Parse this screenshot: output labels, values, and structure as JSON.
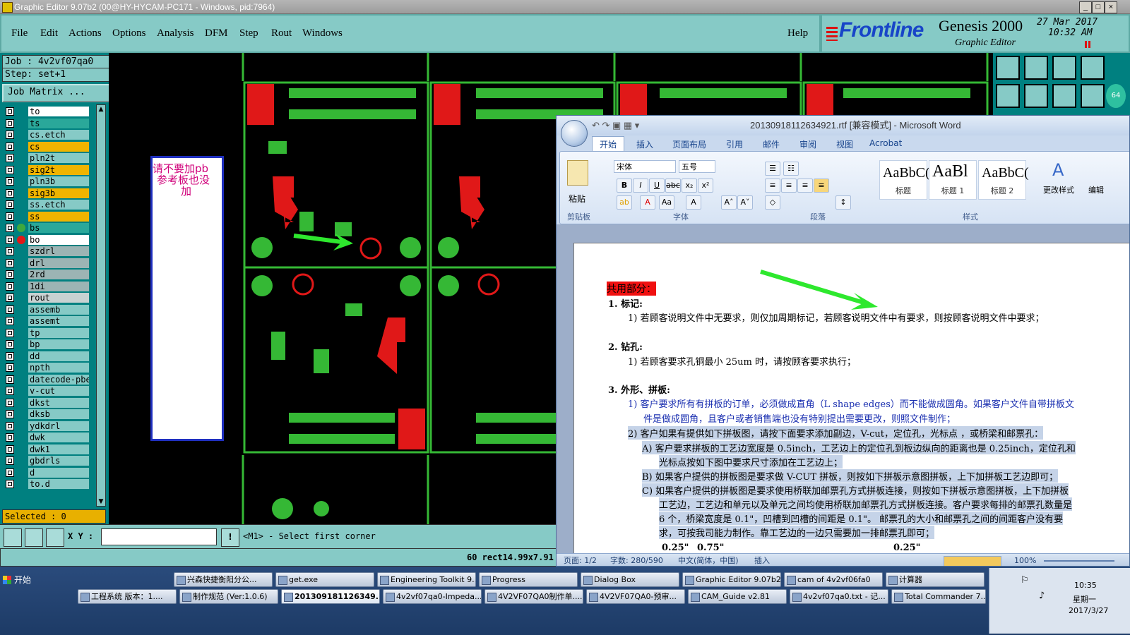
{
  "genesis": {
    "title": "Graphic Editor 9.07b2 (00@HY-HYCAM-PC171 - Windows, pid:7964)",
    "menu": [
      "File",
      "Edit",
      "Actions",
      "Options",
      "Analysis",
      "DFM",
      "Step",
      "Rout",
      "Windows"
    ],
    "help": "Help",
    "brand": "Frontline",
    "product": "Genesis 2000",
    "subtitle": "Graphic Editor",
    "date": "27 Mar 2017",
    "time": "10:32 AM",
    "job": "Job : 4v2vf07qa0",
    "step": "Step: set+1",
    "job_matrix": "Job Matrix ...",
    "layers": [
      {
        "name": "to",
        "bg": "#ffffff",
        "dot": ""
      },
      {
        "name": "ts",
        "bg": "#2aa89a",
        "dot": ""
      },
      {
        "name": "cs.etch",
        "bg": "#86cac6",
        "dot": ""
      },
      {
        "name": "cs",
        "bg": "#f0b400",
        "dot": ""
      },
      {
        "name": "pln2t",
        "bg": "#86cac6",
        "dot": ""
      },
      {
        "name": "sig2t",
        "bg": "#f0b400",
        "dot": ""
      },
      {
        "name": "pln3b",
        "bg": "#86cac6",
        "dot": ""
      },
      {
        "name": "sig3b",
        "bg": "#f0b400",
        "dot": ""
      },
      {
        "name": "ss.etch",
        "bg": "#86cac6",
        "dot": ""
      },
      {
        "name": "ss",
        "bg": "#f0b400",
        "dot": ""
      },
      {
        "name": "bs",
        "bg": "#2aa89a",
        "dot": "#3ea83e"
      },
      {
        "name": "bo",
        "bg": "#ffffff",
        "dot": "#e01818"
      },
      {
        "name": "szdrl",
        "bg": "#9cb4b4",
        "dot": ""
      },
      {
        "name": "drl",
        "bg": "#9cb4b4",
        "dot": ""
      },
      {
        "name": "2rd",
        "bg": "#9cb4b4",
        "dot": ""
      },
      {
        "name": "1di",
        "bg": "#9cb4b4",
        "dot": ""
      },
      {
        "name": "rout",
        "bg": "#c8d2d2",
        "dot": ""
      },
      {
        "name": "assemb",
        "bg": "#86cac6",
        "dot": ""
      },
      {
        "name": "assemt",
        "bg": "#86cac6",
        "dot": ""
      },
      {
        "name": "tp",
        "bg": "#86cac6",
        "dot": ""
      },
      {
        "name": "bp",
        "bg": "#86cac6",
        "dot": ""
      },
      {
        "name": "dd",
        "bg": "#86cac6",
        "dot": ""
      },
      {
        "name": "npth",
        "bg": "#86cac6",
        "dot": ""
      },
      {
        "name": "datecode-pbe",
        "bg": "#86cac6",
        "dot": ""
      },
      {
        "name": "v-cut",
        "bg": "#86cac6",
        "dot": ""
      },
      {
        "name": "dkst",
        "bg": "#86cac6",
        "dot": ""
      },
      {
        "name": "dksb",
        "bg": "#86cac6",
        "dot": ""
      },
      {
        "name": "ydkdrl",
        "bg": "#86cac6",
        "dot": ""
      },
      {
        "name": "dwk",
        "bg": "#86cac6",
        "dot": ""
      },
      {
        "name": "dwk1",
        "bg": "#86cac6",
        "dot": ""
      },
      {
        "name": "gbdrls",
        "bg": "#86cac6",
        "dot": ""
      },
      {
        "name": "d",
        "bg": "#86cac6",
        "dot": ""
      },
      {
        "name": "to.d",
        "bg": "#86cac6",
        "dot": ""
      }
    ],
    "selected": "Selected : 0",
    "xy_label": "X Y :",
    "prompt": "<M1> - Select first corner",
    "status_rect": "60 rect14.99x7.91",
    "note_line1": "请不要加pb",
    "note_line2": "参考板也没",
    "note_line3": "加",
    "badge": "64"
  },
  "word": {
    "title": "20130918112634921.rtf [兼容模式] - Microsoft Word",
    "tabs": [
      "开始",
      "插入",
      "页面布局",
      "引用",
      "邮件",
      "审阅",
      "视图",
      "Acrobat"
    ],
    "paste": "粘贴",
    "font_name": "宋体",
    "font_size": "五号",
    "groups": [
      "剪贴板",
      "字体",
      "段落",
      "样式"
    ],
    "styles": [
      {
        "preview": "AaBbC(",
        "name": "标题"
      },
      {
        "preview": "AaBl",
        "name": "标题 1"
      },
      {
        "preview": "AaBbC(",
        "name": "标题 2"
      }
    ],
    "change_style": "更改样式",
    "edit": "编辑",
    "doc": {
      "heading": "共用部分：",
      "s1": "1.    标记:",
      "s1_1": "1)  若顾客说明文件中无要求，则仅加周期标记，若顾客说明文件中有要求，则按顾客说明文件中要求；",
      "s2": "2.    钻孔:",
      "s2_1": "1)  若顾客要求孔铜最小 25um 时，请按顾客要求执行；",
      "s3": "3.    外形、拼板:",
      "s3_1a": "1)  客户要求所有有拼板的订单，必须做成直角（L shape edges）而不能做成圆角。如果客户文件自带拼板文",
      "s3_1b": "件是做成圆角，且客户或者销售端也没有特别提出需要更改，则照文件制作；",
      "s3_2": "2)  客户如果有提供如下拼板图，请按下面要求添加副边，V-cut，定位孔，光标点 ，或桥梁和邮票孔：",
      "a1": "A)  客户要求拼板的工艺边宽度是 0.5inch，工艺边上的定位孔到板边纵向的距离也是 0.25inch，定位孔和",
      "a2": "光标点按如下图中要求尺寸添加在工艺边上；",
      "b1": "B)  如果客户提供的拼板图是要求做 V-CUT 拼板，则按如下拼板示意图拼板，上下加拼板工艺边即可；",
      "c1": "C)  如果客户提供的拼板图是要求使用桥联加邮票孔方式拼板连接，则按如下拼板示意图拼板，上下加拼板",
      "c2": "工艺边，工艺边和单元以及单元之间均使用桥联加邮票孔方式拼板连接。客户要求每排的邮票孔数量是",
      "c3": "6 个，桥梁宽度是 0.1\"，凹槽到凹槽的间距是 0.1\"。 邮票孔的大小和邮票孔之间的间距客户没有要",
      "c4": "求，可按我司能力制作。靠工艺边的一边只需要加一排邮票孔即可；",
      "dim1": "0.25\"",
      "dim2": "0.75\"",
      "dim3": "0.25\""
    },
    "status": {
      "page": "页面: 1/2",
      "words": "字数: 280/590",
      "lang": "中文(简体，中国)",
      "mode": "插入",
      "zoom": "100%"
    }
  },
  "taskbar": {
    "start": "开始",
    "row1": [
      "兴森快捷衡阳分公...",
      "get.exe",
      "Engineering Toolkit 9....",
      "Progress",
      "Dialog Box",
      "Graphic Editor 9.07b2...",
      "cam of 4v2vf06fa0",
      "计算器"
    ],
    "row2": [
      "工程系统  版本：1....",
      "制作规范 (Ver:1.0.6)",
      "201309181126349...",
      "4v2vf07qa0-Impeda...",
      "4V2VF07QA0制作单....",
      "4V2VF07QA0-预审...",
      "CAM_Guide v2.81",
      "4v2vf07qa0.txt - 记...",
      "Total Commander 7...."
    ],
    "clock_time": "10:35",
    "clock_day": "星期一",
    "clock_date": "2017/3/27"
  }
}
